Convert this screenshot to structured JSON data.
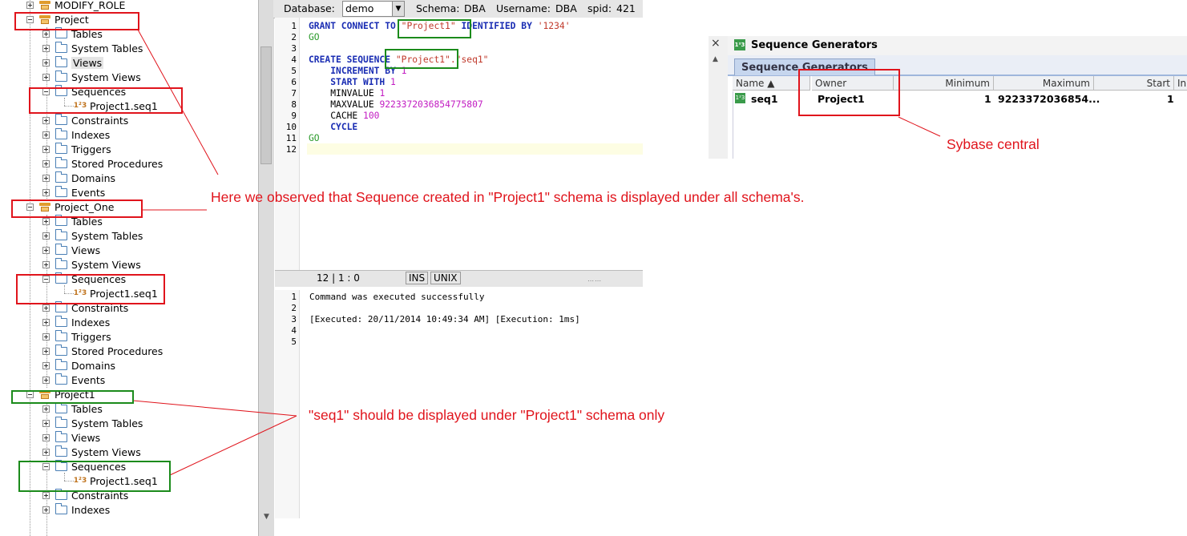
{
  "tree": {
    "top_item": "MODIFY_ROLE",
    "schemas": [
      {
        "name": "Project",
        "children": [
          "Tables",
          "System Tables",
          "Views",
          "System Views",
          "Sequences",
          "Constraints",
          "Indexes",
          "Triggers",
          "Stored Procedures",
          "Domains",
          "Events"
        ],
        "sequence_item": "Project1.seq1"
      },
      {
        "name": "Project_One",
        "children": [
          "Tables",
          "System Tables",
          "Views",
          "System Views",
          "Sequences",
          "Constraints",
          "Indexes",
          "Triggers",
          "Stored Procedures",
          "Domains",
          "Events"
        ],
        "sequence_item": "Project1.seq1"
      },
      {
        "name": "Project1",
        "children": [
          "Tables",
          "System Tables",
          "Views",
          "System Views",
          "Sequences",
          "Constraints",
          "Indexes"
        ],
        "sequence_item": "Project1.seq1"
      }
    ]
  },
  "toolbar": {
    "database_label": "Database:",
    "database_value": "demo",
    "schema_label": "Schema:",
    "schema_value": "DBA",
    "username_label": "Username:",
    "username_value": "DBA",
    "spid_label": "spid:",
    "spid_value": "421"
  },
  "editor": {
    "line_numbers": [
      "1",
      "2",
      "3",
      "4",
      "5",
      "6",
      "7",
      "8",
      "9",
      "10",
      "11",
      "12"
    ],
    "l1_kw1": "GRANT CONNECT TO",
    "l1_str1": "\"Project1\"",
    "l1_kw2": "IDENTIFIED BY",
    "l1_str2": "'1234'",
    "go": "GO",
    "l4_kw": "CREATE SEQUENCE",
    "l4_str1": "\"Project1\"",
    "l4_str2": ".\"seq1\"",
    "l5_kw": "INCREMENT BY",
    "l5_num": "1",
    "l6_kw": "START WITH",
    "l6_num": "1",
    "l7_kw": "MINVALUE",
    "l7_num": "1",
    "l8_kw": "MAXVALUE",
    "l8_num": "9223372036854775807",
    "l9_kw": "CACHE",
    "l9_num": "100",
    "l10_kw": "CYCLE"
  },
  "statusbar": {
    "position": "12 | 1 : 0",
    "mode": "INS",
    "line_ending": "UNIX"
  },
  "output": {
    "line_numbers": [
      "1",
      "2",
      "3",
      "4",
      "5"
    ],
    "line1": "Command was executed successfully",
    "line3": "[Executed: 20/11/2014 10:49:34 AM] [Execution: 1ms]"
  },
  "sybase_central": {
    "title": "Sequence Generators",
    "tab": "Sequence Generators",
    "columns": [
      "Name ▲",
      "Owner",
      "Minimum",
      "Maximum",
      "Start",
      "In"
    ],
    "row": {
      "name": "seq1",
      "owner": "Project1",
      "minimum": "1",
      "maximum": "9223372036854...",
      "start": "1"
    },
    "close_symbol": "×"
  },
  "annotations": {
    "main": "Here we observed that Sequence created in \"Project1\" schema is displayed under all schema's.",
    "should": "\"seq1\" should be displayed under \"Project1\" schema only",
    "sybase": "Sybase central"
  },
  "colors": {
    "annotation_red": "#e0141c",
    "annotation_green": "#1b8b1b",
    "keyword_blue": "#1a2db3"
  }
}
